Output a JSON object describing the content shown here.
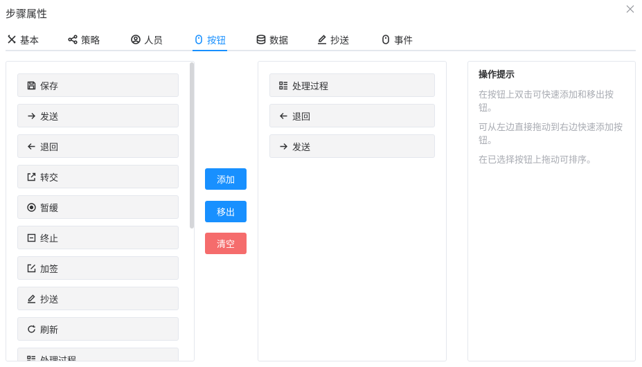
{
  "dialog": {
    "title": "步骤属性"
  },
  "tabs": [
    {
      "label": "基本",
      "icon": "tools-icon"
    },
    {
      "label": "策略",
      "icon": "share-icon"
    },
    {
      "label": "人员",
      "icon": "user-circle-icon"
    },
    {
      "label": "按钮",
      "icon": "mouse-icon",
      "active": true
    },
    {
      "label": "数据",
      "icon": "database-icon"
    },
    {
      "label": "抄送",
      "icon": "edit-icon"
    },
    {
      "label": "事件",
      "icon": "mouse-icon"
    }
  ],
  "available_buttons": [
    {
      "label": "保存",
      "icon": "save-icon"
    },
    {
      "label": "发送",
      "icon": "arrow-right-icon"
    },
    {
      "label": "退回",
      "icon": "arrow-left-icon"
    },
    {
      "label": "转交",
      "icon": "export-icon"
    },
    {
      "label": "暂缓",
      "icon": "record-icon"
    },
    {
      "label": "终止",
      "icon": "minus-square-icon"
    },
    {
      "label": "加签",
      "icon": "edit-square-icon"
    },
    {
      "label": "抄送",
      "icon": "edit-icon"
    },
    {
      "label": "刷新",
      "icon": "refresh-icon"
    },
    {
      "label": "处理过程",
      "icon": "list-icon"
    }
  ],
  "actions": {
    "add": "添加",
    "remove": "移出",
    "clear": "清空"
  },
  "selected_buttons": [
    {
      "label": "处理过程",
      "icon": "list-icon"
    },
    {
      "label": "退回",
      "icon": "arrow-left-icon"
    },
    {
      "label": "发送",
      "icon": "arrow-right-icon"
    }
  ],
  "tips": {
    "title": "操作提示",
    "lines": [
      "在按钮上双击可快速添加和移出按钮。",
      "可从左边直接拖动到右边快速添加按钮。",
      "在已选择按钮上拖动可排序。"
    ]
  },
  "colors": {
    "primary": "#1890ff",
    "danger": "#f56c6c",
    "item_bg": "#f4f4f5",
    "border": "#e4e7ed"
  }
}
